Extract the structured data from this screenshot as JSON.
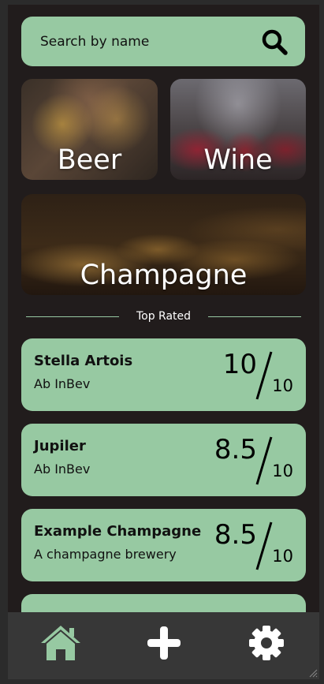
{
  "search": {
    "placeholder": "Search by name"
  },
  "categories": {
    "beer": "Beer",
    "wine": "Wine",
    "champagne": "Champagne"
  },
  "top_rated": {
    "heading": "Top Rated",
    "items": [
      {
        "name": "Stella Artois",
        "brewery": "Ab InBev",
        "score": "10",
        "max": "10"
      },
      {
        "name": "Jupiler",
        "brewery": "Ab InBev",
        "score": "8.5",
        "max": "10"
      },
      {
        "name": "Example Champagne",
        "brewery": "A champagne brewery",
        "score": "8.5",
        "max": "10"
      }
    ]
  },
  "navbar": {
    "items": [
      {
        "icon": "home-icon",
        "active": true
      },
      {
        "icon": "plus-icon",
        "active": false
      },
      {
        "icon": "gear-icon",
        "active": false
      }
    ]
  },
  "colors": {
    "accent": "#97c9a2",
    "background": "#211c1c",
    "navbar": "#373737"
  }
}
